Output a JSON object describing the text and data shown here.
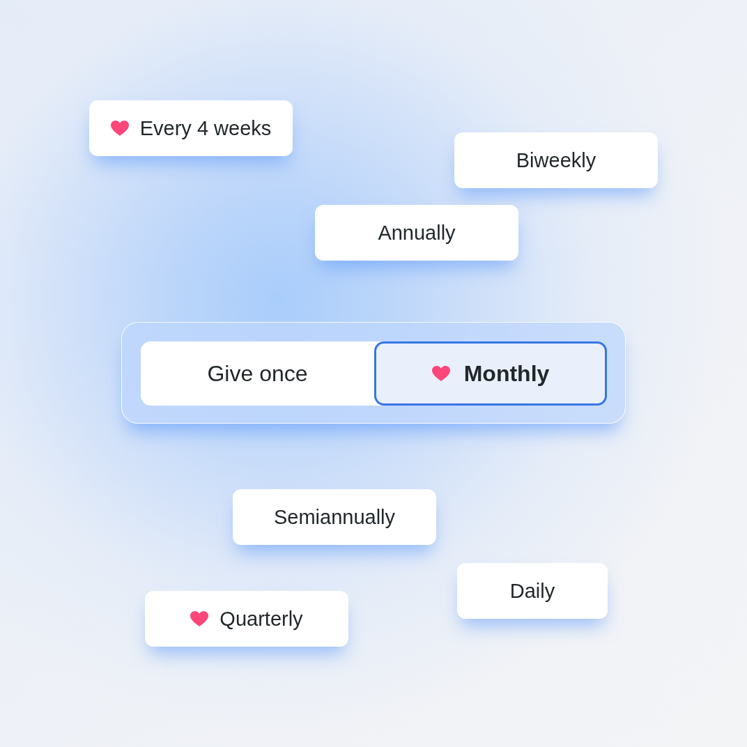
{
  "chips": [
    {
      "label": "Every 4 weeks",
      "heart": true
    },
    {
      "label": "Biweekly",
      "heart": false
    },
    {
      "label": "Annually",
      "heart": false
    },
    {
      "label": "Semiannually",
      "heart": false
    },
    {
      "label": "Daily",
      "heart": false
    },
    {
      "label": "Quarterly",
      "heart": true
    }
  ],
  "toggle": {
    "options": [
      {
        "label": "Give once",
        "selected": false,
        "heart": false
      },
      {
        "label": "Monthly",
        "selected": true,
        "heart": true
      }
    ]
  }
}
